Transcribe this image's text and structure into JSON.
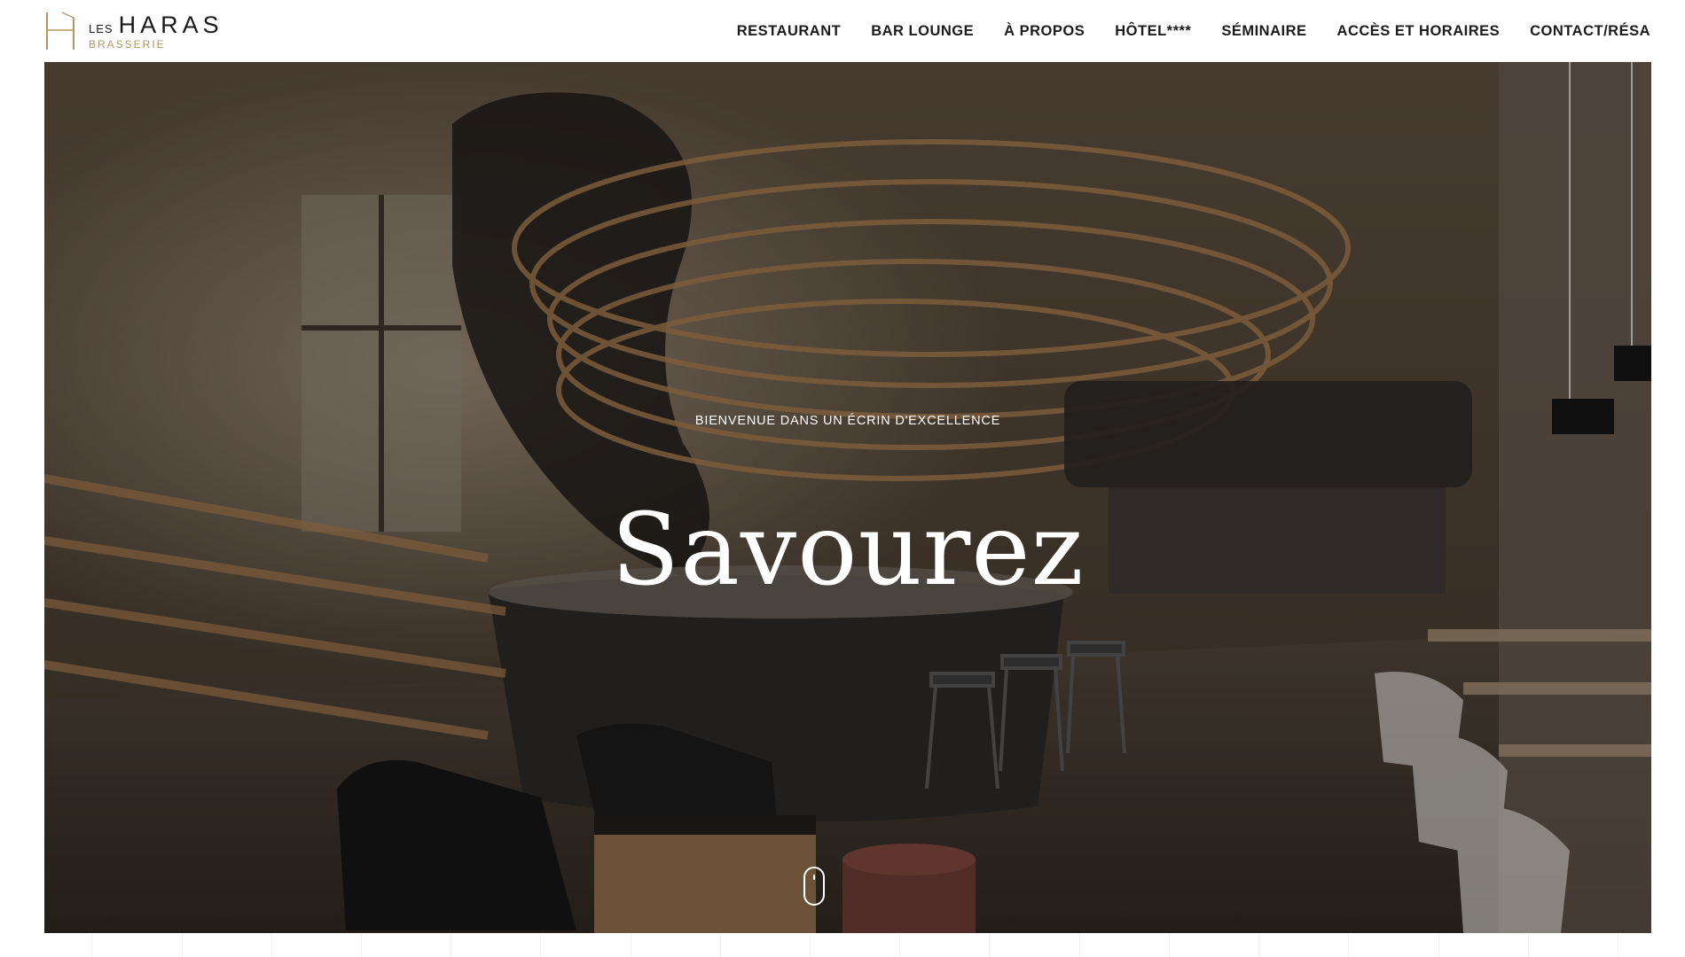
{
  "brand": {
    "les": "LES",
    "haras": "HARAS",
    "brasserie": "BRASSERIE",
    "gold_color": "#b89560"
  },
  "nav": {
    "items": [
      {
        "label": "RESTAURANT"
      },
      {
        "label": "BAR LOUNGE"
      },
      {
        "label": "À PROPOS"
      },
      {
        "label": "HÔTEL****"
      },
      {
        "label": "SÉMINAIRE"
      },
      {
        "label": "ACCÈS ET HORAIRES"
      },
      {
        "label": "CONTACT/RÉSA"
      }
    ]
  },
  "hero": {
    "subtitle": "BIENVENUE DANS UN ÉCRIN D'EXCELLENCE",
    "title": "Savourez",
    "scroll_icon": "scroll-mouse-icon"
  }
}
